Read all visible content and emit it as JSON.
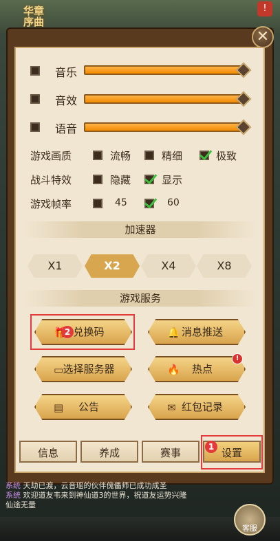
{
  "audio": {
    "music_label": "音乐",
    "sfx_label": "音效",
    "voice_label": "语音",
    "music_level": 1.0,
    "sfx_level": 1.0,
    "voice_level": 1.0
  },
  "quality": {
    "label": "游戏画质",
    "options": [
      "流畅",
      "精细",
      "极致"
    ],
    "selected": "极致"
  },
  "effects": {
    "label": "战斗特效",
    "options": [
      "隐藏",
      "显示"
    ],
    "selected": "显示"
  },
  "fps": {
    "label": "游戏帧率",
    "options": [
      "45",
      "60"
    ],
    "selected": "60"
  },
  "accelerator": {
    "title": "加速器",
    "options": [
      "X1",
      "X2",
      "X4",
      "X8"
    ],
    "selected": "X2"
  },
  "services": {
    "title": "游戏服务",
    "redeem": "兑换码",
    "push": "消息推送",
    "server": "选择服务器",
    "hot": "热点",
    "notice": "公告",
    "redpacket": "红包记录",
    "redeem_badge": "2",
    "hot_badge": "!"
  },
  "tabs": {
    "info": "信息",
    "grow": "养成",
    "match": "赛事",
    "settings": "设置",
    "settings_badge": "1"
  },
  "chat": {
    "line1_tag": "系统",
    "line1": "天劫已渡，云音瑶的伙伴傀儡师已成功成圣",
    "line2_tag": "系统",
    "line2": "欢迎道友韦来到神仙道3的世界，祝道友运势兴隆",
    "line3": "仙途无量"
  },
  "support_label": "客服",
  "colors": {
    "accent": "#d9a44d",
    "highlight": "#e33b3b",
    "check": "#3fbf3f"
  }
}
